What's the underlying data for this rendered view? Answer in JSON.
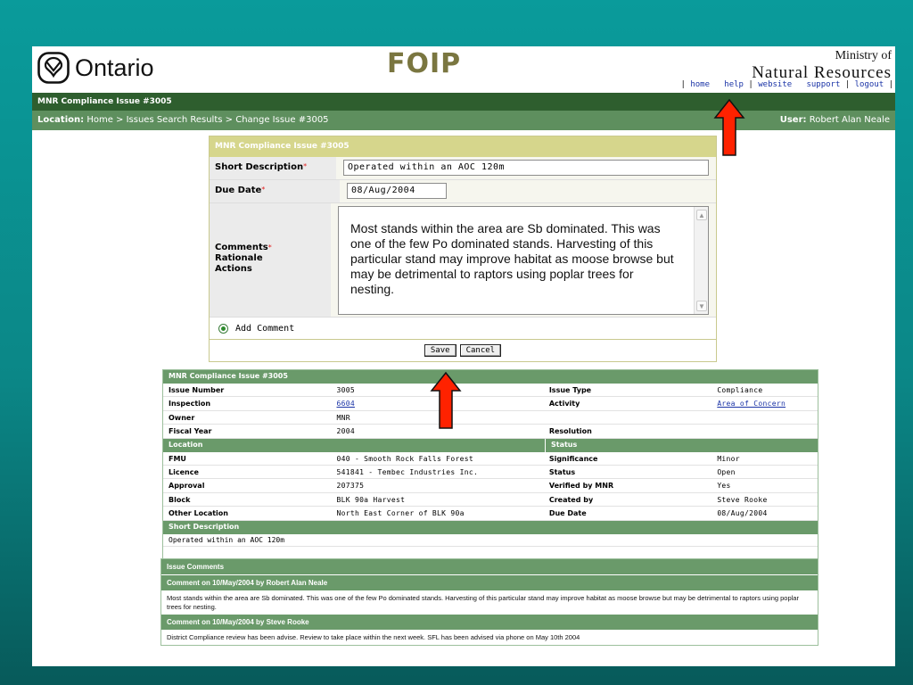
{
  "header": {
    "logo_text": "Ontario",
    "app_title": "FOIP",
    "ministry_line1": "Ministry of",
    "ministry_line2": "Natural Resources",
    "links": [
      "home",
      "help",
      "website",
      "support",
      "logout"
    ]
  },
  "bar1": {
    "title": "MNR Compliance Issue #3005"
  },
  "bar2": {
    "location_label": "Location:",
    "location_path": "Home > Issues Search Results > Change Issue #3005",
    "user_label": "User:",
    "user_name": "Robert Alan Neale"
  },
  "form": {
    "title": "MNR Compliance Issue #3005",
    "short_desc_label": "Short Description",
    "short_desc_value": "Operated within an AOC 120m",
    "due_date_label": "Due Date",
    "due_date_value": "08/Aug/2004",
    "comments_label_1": "Comments",
    "comments_label_2": "Rationale",
    "comments_label_3": "Actions",
    "comments_value": "Most stands within the area are Sb dominated. This was one of the few Po dominated stands. Harvesting of this particular stand may improve habitat as moose browse but may be detrimental to raptors using poplar trees for nesting.",
    "add_comment_label": "Add Comment",
    "save_label": "Save",
    "cancel_label": "Cancel",
    "required_mark": "*"
  },
  "detail": {
    "header": "MNR Compliance Issue #3005",
    "rows_a": [
      [
        "Issue Number",
        "3005",
        "Issue Type",
        "Compliance"
      ],
      [
        "Inspection",
        "6604",
        "Activity",
        "Area of Concern"
      ],
      [
        "Owner",
        "MNR",
        "",
        ""
      ],
      [
        "Fiscal Year",
        "2004",
        "Resolution",
        ""
      ]
    ],
    "location_header": "Location",
    "status_header": "Status",
    "rows_b": [
      [
        "FMU",
        "040 - Smooth Rock Falls Forest",
        "Significance",
        "Minor"
      ],
      [
        "Licence",
        "541841 - Tembec Industries Inc.",
        "Status",
        "Open"
      ],
      [
        "Approval",
        "207375",
        "Verified by MNR",
        "Yes"
      ],
      [
        "Block",
        "BLK 90a Harvest",
        "Created by",
        "Steve Rooke"
      ],
      [
        "Other Location",
        "North East Corner of BLK 90a",
        "Due Date",
        "08/Aug/2004"
      ]
    ],
    "short_desc_header": "Short Description",
    "short_desc_value": "Operated within an AOC 120m"
  },
  "comments": {
    "header": "Issue Comments",
    "items": [
      {
        "title": "Comment on 10/May/2004 by Robert Alan Neale",
        "text": "Most stands within the area are Sb dominated. This was one of the few Po dominated stands. Harvesting of this particular stand may improve habitat as moose browse but may be detrimental to raptors using poplar trees for nesting."
      },
      {
        "title": "Comment on 10/May/2004 by Steve Rooke",
        "text": "District Compliance review has been advise. Review to take place within the next week. SFL has been advised via phone on May 10th 2004"
      }
    ]
  },
  "colors": {
    "dark_green": "#2e5e2e",
    "mid_green": "#5e8f5e",
    "table_green": "#6a9a6a",
    "form_khaki": "#d6d68c",
    "arrow_red": "#ff2200",
    "background_teal": "#0b8787"
  },
  "icons": {
    "logo": "trillium-logo-icon",
    "arrows": "red-up-arrow-icon"
  }
}
